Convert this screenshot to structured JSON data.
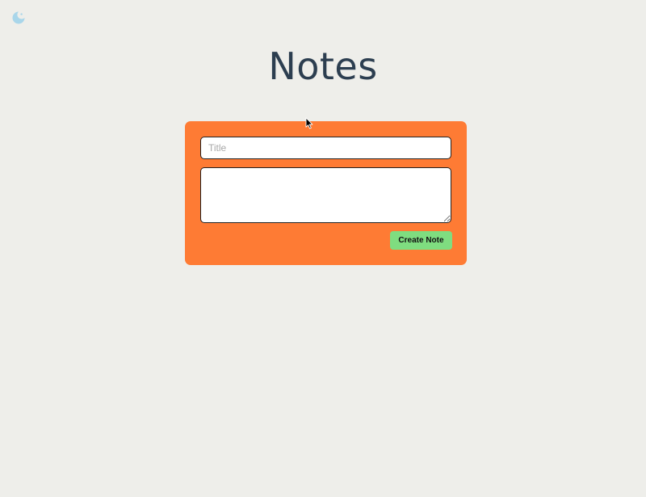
{
  "header": {
    "theme_toggle_icon": "moon-icon",
    "title": "Notes"
  },
  "note_form": {
    "title_placeholder": "Title",
    "title_value": "",
    "body_placeholder": "",
    "body_value": "",
    "create_button_label": "Create Note"
  },
  "colors": {
    "background": "#eeeeea",
    "form_background": "#fe7b34",
    "title_text": "#2c3e50",
    "button_background": "#7fdd80",
    "moon_icon": "#a9d6ea"
  }
}
